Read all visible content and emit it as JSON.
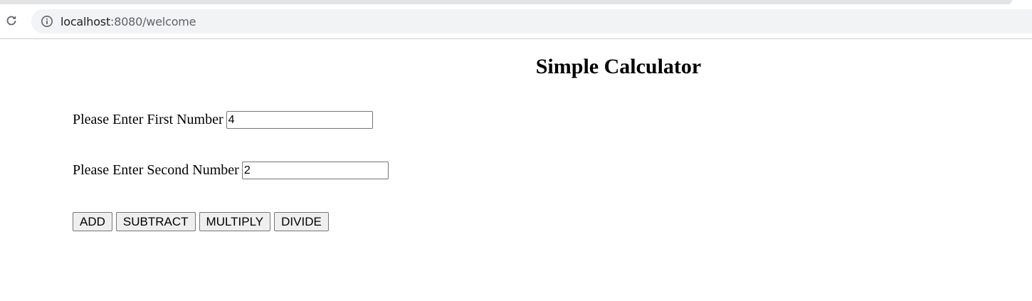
{
  "browser": {
    "url_host": "localhost",
    "url_rest": ":8080/welcome",
    "reload_icon": "reload-icon",
    "info_icon": "info-icon"
  },
  "page": {
    "title": "Simple Calculator",
    "first_number": {
      "label": "Please Enter First Number",
      "value": "4"
    },
    "second_number": {
      "label": "Please Enter Second Number",
      "value": "2"
    },
    "buttons": {
      "add": "ADD",
      "subtract": "SUBTRACT",
      "multiply": "MULTIPLY",
      "divide": "DIVIDE"
    }
  }
}
